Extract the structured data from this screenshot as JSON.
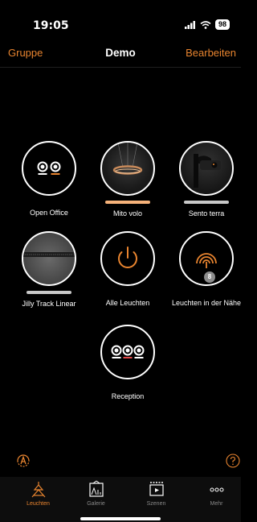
{
  "status": {
    "time": "19:05",
    "battery": "98"
  },
  "nav": {
    "left": "Gruppe",
    "title": "Demo",
    "right": "Bearbeiten"
  },
  "tiles": [
    {
      "label": "Open Office",
      "icon": "two-lights-icon",
      "bar_color": ""
    },
    {
      "label": "Mito volo",
      "icon": "pendant-ring-photo",
      "bar_color": "#f6b27a"
    },
    {
      "label": "Sento terra",
      "icon": "floor-lamp-photo",
      "bar_color": "#c8c8c8"
    },
    {
      "label": "Jilly Track Linear",
      "icon": "track-light-photo",
      "bar_color": "#c8c8c8"
    },
    {
      "label": "Alle Leuchten",
      "icon": "power-icon",
      "bar_color": ""
    },
    {
      "label": "Leuchten in der Nähe",
      "icon": "signal-icon",
      "badge": "8",
      "bar_color": ""
    },
    {
      "label": "Reception",
      "icon": "three-lights-icon",
      "bar_color": ""
    }
  ],
  "tabs": [
    {
      "label": "Leuchten",
      "icon": "lamp-icon",
      "active": true
    },
    {
      "label": "Galerie",
      "icon": "gallery-icon",
      "active": false
    },
    {
      "label": "Szenen",
      "icon": "scenes-icon",
      "active": false
    },
    {
      "label": "Mehr",
      "icon": "more-icon",
      "active": false
    }
  ],
  "colors": {
    "accent": "#e8842f"
  }
}
